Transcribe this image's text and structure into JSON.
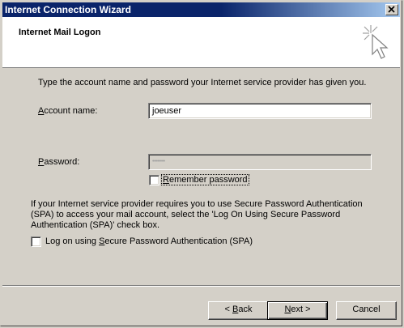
{
  "window": {
    "title": "Internet Connection Wizard",
    "close_glyph": "✕"
  },
  "header": {
    "title": "Internet Mail Logon",
    "icon": "wizard-wand-icon"
  },
  "instructions": "Type the account name and password your Internet service provider has given you.",
  "account": {
    "label_prefix": "",
    "label_accel": "A",
    "label_rest": "ccount name:",
    "value": "joeuser"
  },
  "password": {
    "label_accel": "P",
    "label_rest": "assword:",
    "value": "••••••••"
  },
  "remember": {
    "label_accel": "R",
    "label_rest": "emember password",
    "checked": false
  },
  "spa": {
    "text": "If your Internet service provider requires you to use Secure Password Authentication (SPA) to access your mail account, select the 'Log On Using Secure Password Authentication (SPA)' check box.",
    "checkbox_prefix": "Log on using ",
    "checkbox_accel": "S",
    "checkbox_rest": "ecure Password Authentication (SPA)",
    "checked": false
  },
  "buttons": {
    "back_prefix": "< ",
    "back_accel": "B",
    "back_rest": "ack",
    "next_accel": "N",
    "next_rest": "ext >",
    "cancel": "Cancel"
  }
}
